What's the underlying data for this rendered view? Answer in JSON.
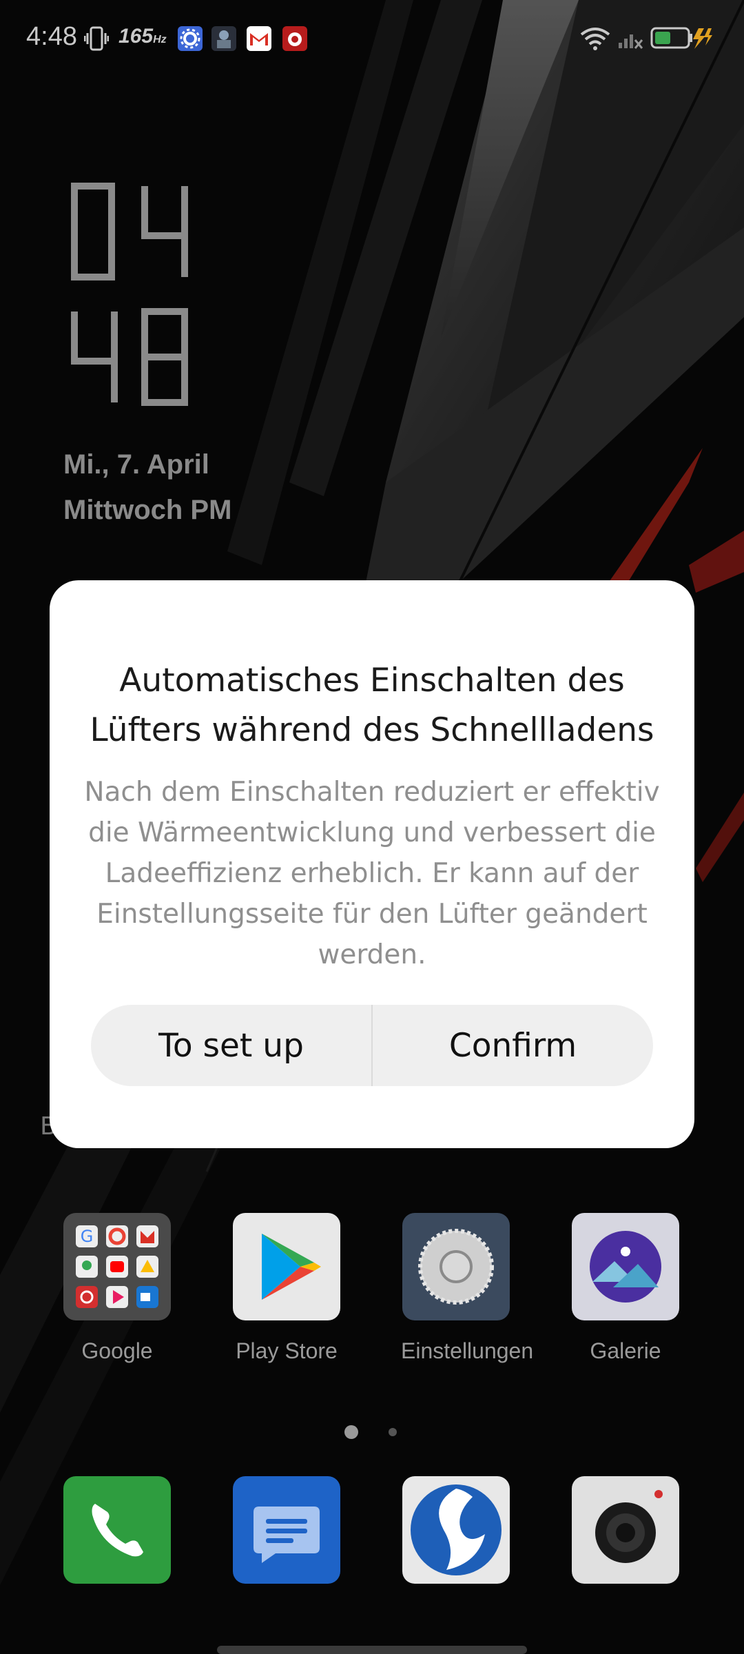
{
  "status_bar": {
    "time": "4:48",
    "refresh_rate": "165",
    "refresh_unit": "Hz",
    "icons": [
      "vibrate-icon",
      "settings-app-icon",
      "game-app-icon",
      "gmail-icon",
      "antutu-icon",
      "wifi-icon",
      "signal-off-icon",
      "battery-charging-icon"
    ]
  },
  "lockscreen": {
    "clock_hour": "04",
    "clock_minute": "48",
    "date_line1": "Mi., 7. April",
    "date_line2": "Mittwoch PM"
  },
  "dialog": {
    "title": "Automatisches Einschalten des Lüfters während des Schnellladens",
    "body": "Nach dem Einschalten reduziert er effektiv die Wärmeentwicklung und verbessert die Ladeeffizienz erheblich. Er kann auf der Einstellungsseite für den Lüfter geändert werden.",
    "button_left": "To set up",
    "button_right": "Confirm"
  },
  "obscured_text": "B",
  "apps": [
    {
      "label": "Google",
      "icon": "google-folder-icon"
    },
    {
      "label": "Play Store",
      "icon": "play-store-icon"
    },
    {
      "label": "Einstellungen",
      "icon": "settings-gear-icon"
    },
    {
      "label": "Galerie",
      "icon": "gallery-icon"
    }
  ],
  "dock": [
    "phone-icon",
    "messages-icon",
    "browser-icon",
    "camera-icon"
  ],
  "page_indicator": {
    "pages": 2,
    "current": 1
  },
  "colors": {
    "accent_red": "#c0261b",
    "dialog_bg": "#ffffff",
    "button_bg": "#efefef",
    "phone_green": "#2e9d3f",
    "messages_blue": "#1e63c7"
  }
}
